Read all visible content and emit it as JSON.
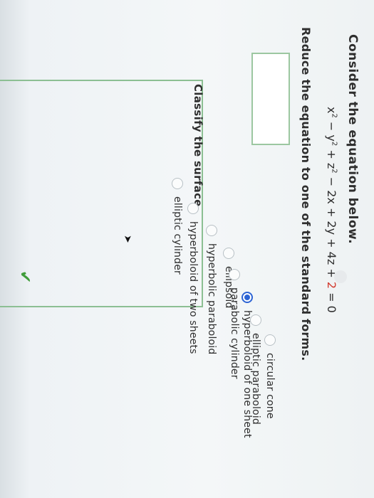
{
  "question": {
    "title": "Consider the equation below.",
    "equation": {
      "x2": "x",
      "minus_y2": " − y",
      "plus_z2": " + z",
      "rest": " − 2x + 2y + 4z + ",
      "red_constant": "2",
      "equals": " = 0",
      "sup2": "2"
    },
    "reduce_prompt": "Reduce the equation to one of the standard forms.",
    "answer_value": ""
  },
  "classify": {
    "prompt": "Classify the surface.",
    "options": [
      {
        "label": "elliptic cylinder",
        "selected": false
      },
      {
        "label": "hyperboloid of two sheets",
        "selected": false
      },
      {
        "label": "hyperbolic paraboloid",
        "selected": false
      },
      {
        "label": "ellipsoid",
        "selected": false
      },
      {
        "label": "parabolic cylinder",
        "selected": false
      },
      {
        "label": "hyperboloid of one sheet",
        "selected": true
      },
      {
        "label": "elliptic paraboloid",
        "selected": false
      },
      {
        "label": "circular cone",
        "selected": false
      }
    ],
    "feedback_icon": "checkmark-icon",
    "accent_color": "#2c64d4",
    "correct_color": "#3f9c3a"
  }
}
